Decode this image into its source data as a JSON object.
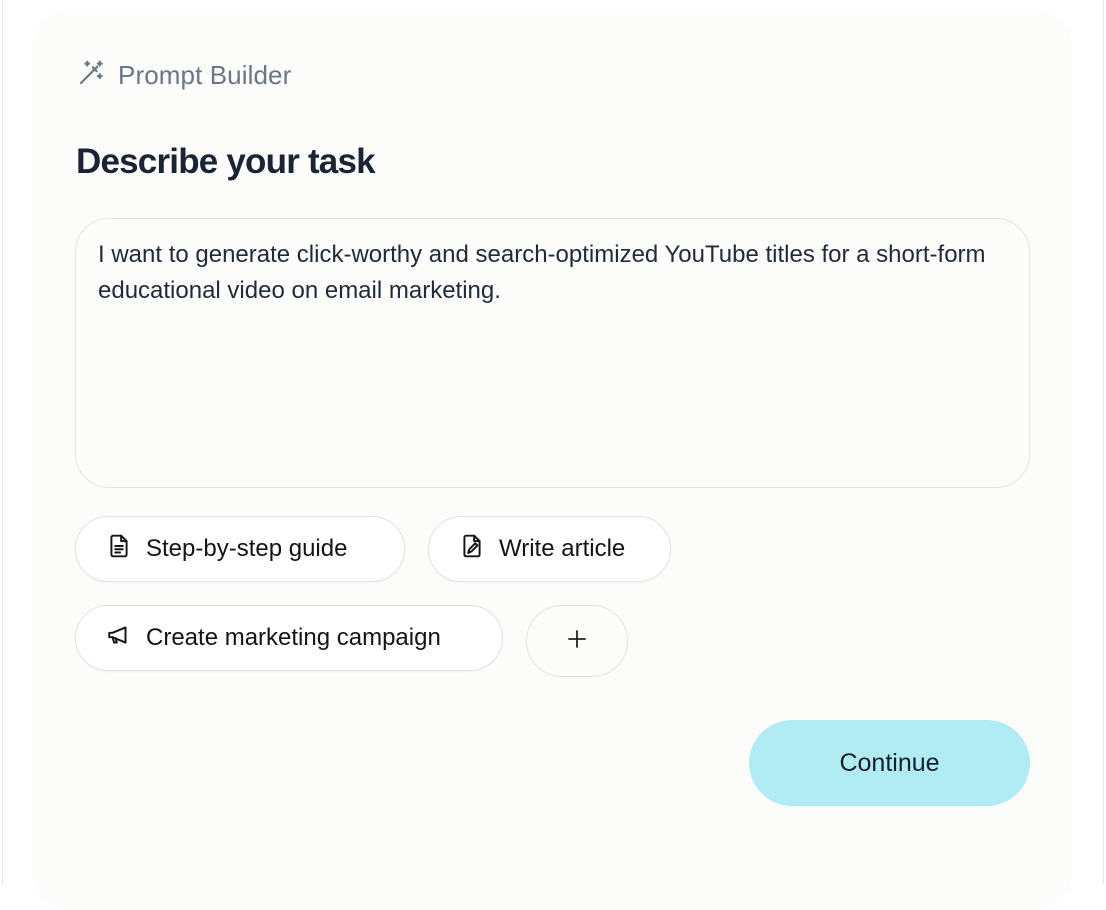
{
  "header": {
    "icon": "magic-wand-icon",
    "title": "Prompt Builder"
  },
  "page_title": "Describe your task",
  "task_input": {
    "value": "I want to generate click-worthy and search-optimized YouTube titles for a short-form educational video on email marketing."
  },
  "chips": [
    {
      "label": "Step-by-step guide",
      "icon": "document-icon"
    },
    {
      "label": "Write article",
      "icon": "pen-file-icon"
    },
    {
      "label": "Create marketing campaign",
      "icon": "megaphone-icon"
    }
  ],
  "add_chip": {
    "icon": "plus-icon"
  },
  "continue_label": "Continue",
  "colors": {
    "card_bg": "#fcfcfa",
    "accent": "#b1ebf4",
    "title": "#1b2434",
    "muted": "#6b7684"
  }
}
